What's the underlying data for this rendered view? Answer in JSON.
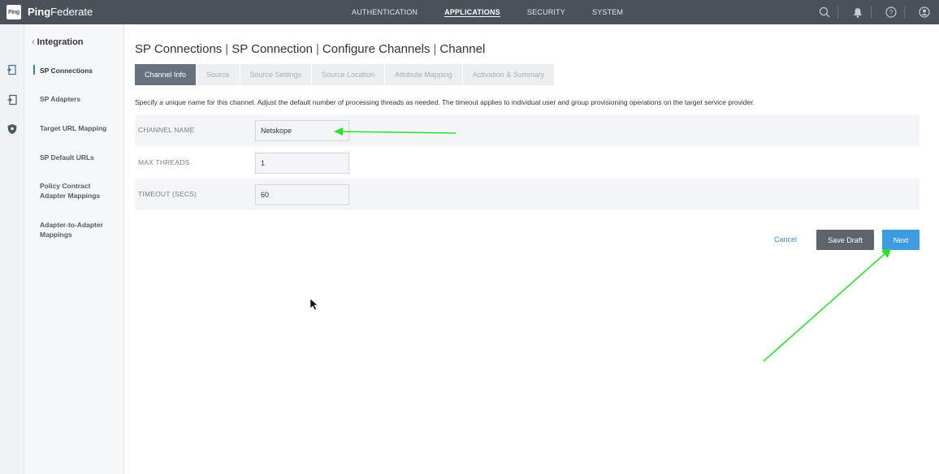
{
  "header": {
    "logo_text": "Ping",
    "app_name_bold": "Ping",
    "app_name_rest": "Federate",
    "nav": [
      {
        "label": "AUTHENTICATION"
      },
      {
        "label": "APPLICATIONS",
        "active": true
      },
      {
        "label": "SECURITY"
      },
      {
        "label": "SYSTEM"
      }
    ],
    "icons": [
      "search-icon",
      "bell-icon",
      "help-icon",
      "user-icon"
    ]
  },
  "rail": {
    "icons": [
      "applications-icon",
      "adapters-icon",
      "shield-icon"
    ]
  },
  "sidebar": {
    "back_label": "Integration",
    "items": [
      {
        "label": "SP Connections",
        "active": true
      },
      {
        "label": "SP Adapters"
      },
      {
        "label": "Target URL Mapping"
      },
      {
        "label": "SP Default URLs"
      },
      {
        "label": "Policy Contract Adapter Mappings"
      },
      {
        "label": "Adapter-to-Adapter Mappings"
      }
    ]
  },
  "main": {
    "breadcrumb": [
      "SP Connections",
      "SP Connection",
      "Configure Channels",
      "Channel"
    ],
    "breadcrumb_sep": "|",
    "tabs": [
      {
        "label": "Channel Info",
        "active": true
      },
      {
        "label": "Source"
      },
      {
        "label": "Source Settings"
      },
      {
        "label": "Source Location"
      },
      {
        "label": "Attribute Mapping"
      },
      {
        "label": "Activation & Summary"
      }
    ],
    "description": "Specify a unique name for this channel. Adjust the default number of processing threads as needed. The timeout applies to individual user and group provisioning operations on the target service provider.",
    "fields": [
      {
        "label": "CHANNEL NAME",
        "value": "Netskope"
      },
      {
        "label": "MAX THREADS",
        "value": "1"
      },
      {
        "label": "TIMEOUT (SECS)",
        "value": "60"
      }
    ],
    "buttons": {
      "cancel": "Cancel",
      "save_draft": "Save Draft",
      "next": "Next"
    }
  },
  "colors": {
    "topbar": "#4b5159",
    "active_tab": "#67717b",
    "next_button": "#3d9be0",
    "save_button": "#5d646c",
    "annotation_arrow": "#2ee02e"
  }
}
